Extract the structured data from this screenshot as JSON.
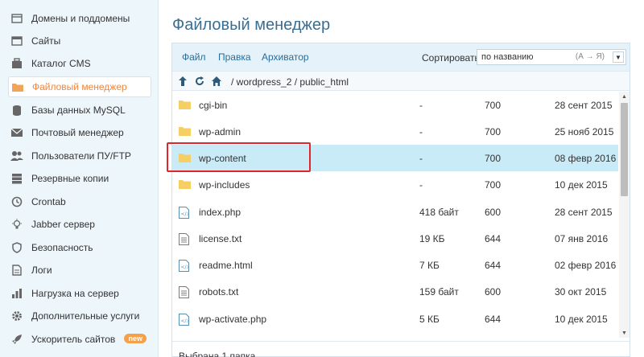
{
  "sidebar": {
    "items": [
      {
        "label": "Домены и поддомены",
        "icon": "domains-icon"
      },
      {
        "label": "Сайты",
        "icon": "sites-icon"
      },
      {
        "label": "Каталог CMS",
        "icon": "cms-catalog-icon"
      },
      {
        "label": "Файловый менеджер",
        "icon": "folder-icon",
        "active": true
      },
      {
        "label": "Базы данных MySQL",
        "icon": "database-icon"
      },
      {
        "label": "Почтовый менеджер",
        "icon": "mail-icon"
      },
      {
        "label": "Пользователи ПУ/FTP",
        "icon": "users-icon"
      },
      {
        "label": "Резервные копии",
        "icon": "backup-icon"
      },
      {
        "label": "Crontab",
        "icon": "clock-icon"
      },
      {
        "label": "Jabber сервер",
        "icon": "bulb-icon"
      },
      {
        "label": "Безопасность",
        "icon": "shield-icon"
      },
      {
        "label": "Логи",
        "icon": "logs-icon"
      },
      {
        "label": "Нагрузка на сервер",
        "icon": "chart-icon"
      },
      {
        "label": "Дополнительные услуги",
        "icon": "gear-icon"
      },
      {
        "label": "Ускоритель сайтов",
        "icon": "rocket-icon",
        "badge": "new"
      }
    ]
  },
  "main": {
    "title": "Файловый менеджер",
    "menu": {
      "file": "Файл",
      "edit": "Правка",
      "archiver": "Архиватор"
    },
    "sort": {
      "label": "Сортировать:",
      "value": "по названию",
      "order": "(А → Я)"
    },
    "path": "/ wordpress_2 / public_html",
    "files": [
      {
        "name": "cgi-bin",
        "type": "folder",
        "size": "-",
        "perm": "700",
        "date": "28 сент 2015"
      },
      {
        "name": "wp-admin",
        "type": "folder",
        "size": "-",
        "perm": "700",
        "date": "25 нояб 2015"
      },
      {
        "name": "wp-content",
        "type": "folder",
        "size": "-",
        "perm": "700",
        "date": "08 февр 2016",
        "selected": true
      },
      {
        "name": "wp-includes",
        "type": "folder",
        "size": "-",
        "perm": "700",
        "date": "10 дек 2015"
      },
      {
        "name": "index.php",
        "type": "file",
        "size": "418 байт",
        "perm": "600",
        "date": "28 сент 2015"
      },
      {
        "name": "license.txt",
        "type": "file",
        "size": "19 КБ",
        "perm": "644",
        "date": "07 янв 2016"
      },
      {
        "name": "readme.html",
        "type": "file",
        "size": "7 КБ",
        "perm": "644",
        "date": "02 февр 2016"
      },
      {
        "name": "robots.txt",
        "type": "file",
        "size": "159 байт",
        "perm": "600",
        "date": "30 окт 2015"
      },
      {
        "name": "wp-activate.php",
        "type": "file",
        "size": "5 КБ",
        "perm": "644",
        "date": "10 дек 2015"
      }
    ],
    "status": "Выбрана 1 папка"
  },
  "colors": {
    "accent": "#f0863e",
    "link": "#2a6d99",
    "title": "#3a6e92",
    "selected_row": "#c9ebf7",
    "highlight": "#e0262c",
    "folder": "#f5cf63"
  }
}
